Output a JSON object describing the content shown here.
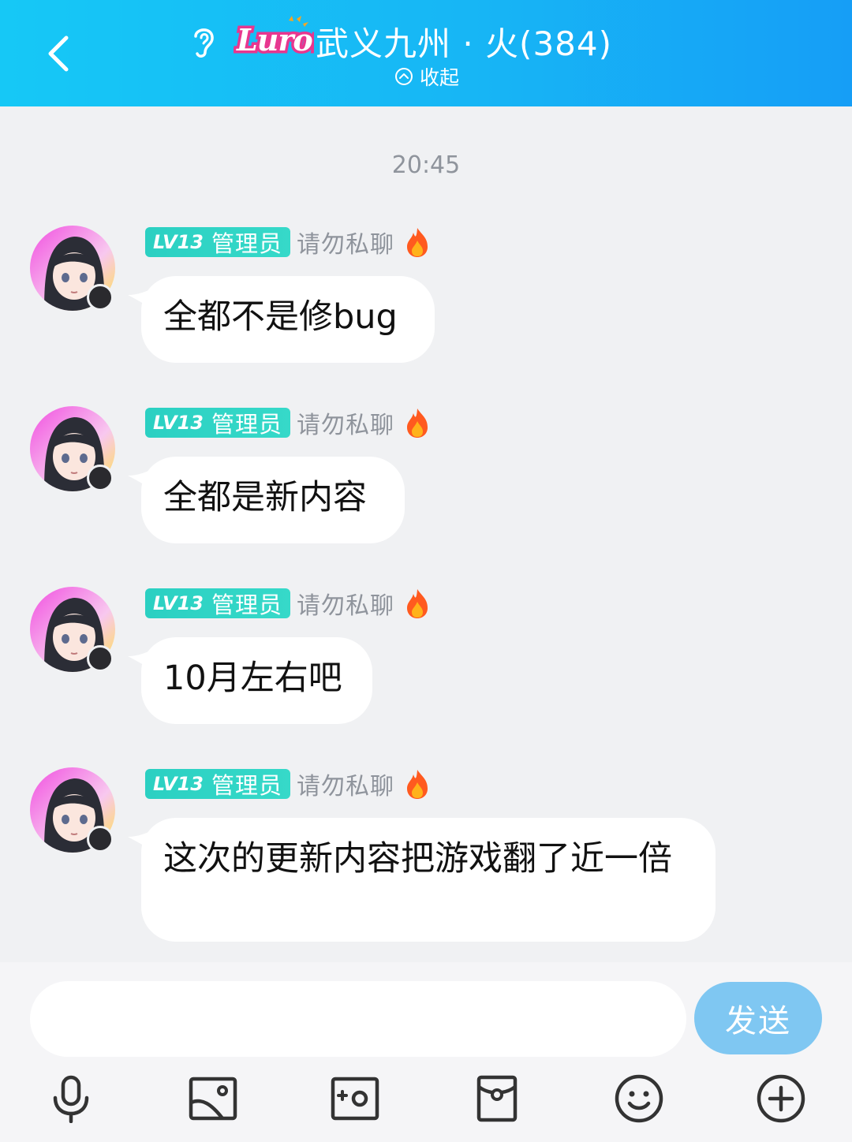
{
  "header": {
    "logo_text": "Luron",
    "title": "武义九州 · 火(384)",
    "collapse_label": "收起"
  },
  "timestamp": "20:45",
  "messages": [
    {
      "level": "LV13",
      "role": "管理员",
      "nickname": "请勿私聊",
      "text": "全都不是修bug"
    },
    {
      "level": "LV13",
      "role": "管理员",
      "nickname": "请勿私聊",
      "text": "全都是新内容"
    },
    {
      "level": "LV13",
      "role": "管理员",
      "nickname": "请勿私聊",
      "text": "10月左右吧"
    },
    {
      "level": "LV13",
      "role": "管理员",
      "nickname": "请勿私聊",
      "text": "这次的更新内容把游戏翻了近一倍"
    }
  ],
  "composer": {
    "input_value": "",
    "send_label": "发送",
    "tools": [
      "microphone-icon",
      "image-icon",
      "camera-icon",
      "red-packet-icon",
      "emoji-icon",
      "plus-icon"
    ]
  },
  "colors": {
    "header_start": "#16c8f6",
    "header_end": "#169ef6",
    "badge": "#2bd0c2",
    "send_button": "#7fc7f2",
    "background": "#f0f1f3"
  }
}
